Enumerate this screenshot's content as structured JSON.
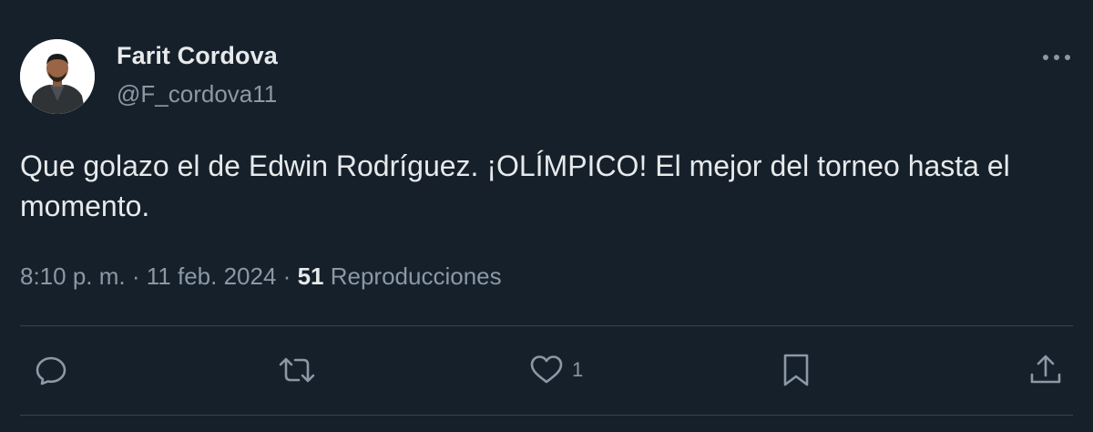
{
  "author": {
    "display_name": "Farit Cordova",
    "handle": "@F_cordova11"
  },
  "tweet": {
    "text": "Que golazo el de Edwin Rodríguez. ¡OLÍMPICO! El mejor del torneo hasta el momento.",
    "time": "8:10 p. m.",
    "separator": "·",
    "date": "11 feb. 2024",
    "views_count": "51",
    "views_label": "Reproducciones"
  },
  "actions": {
    "reply": {
      "icon": "reply-icon"
    },
    "retweet": {
      "icon": "retweet-icon"
    },
    "like": {
      "icon": "heart-icon",
      "count": "1"
    },
    "bookmark": {
      "icon": "bookmark-icon"
    },
    "share": {
      "icon": "share-icon"
    }
  },
  "colors": {
    "background": "#15202b",
    "primary_text": "#e7e9ea",
    "secondary_text": "#8b98a5",
    "divider": "#38444d"
  }
}
